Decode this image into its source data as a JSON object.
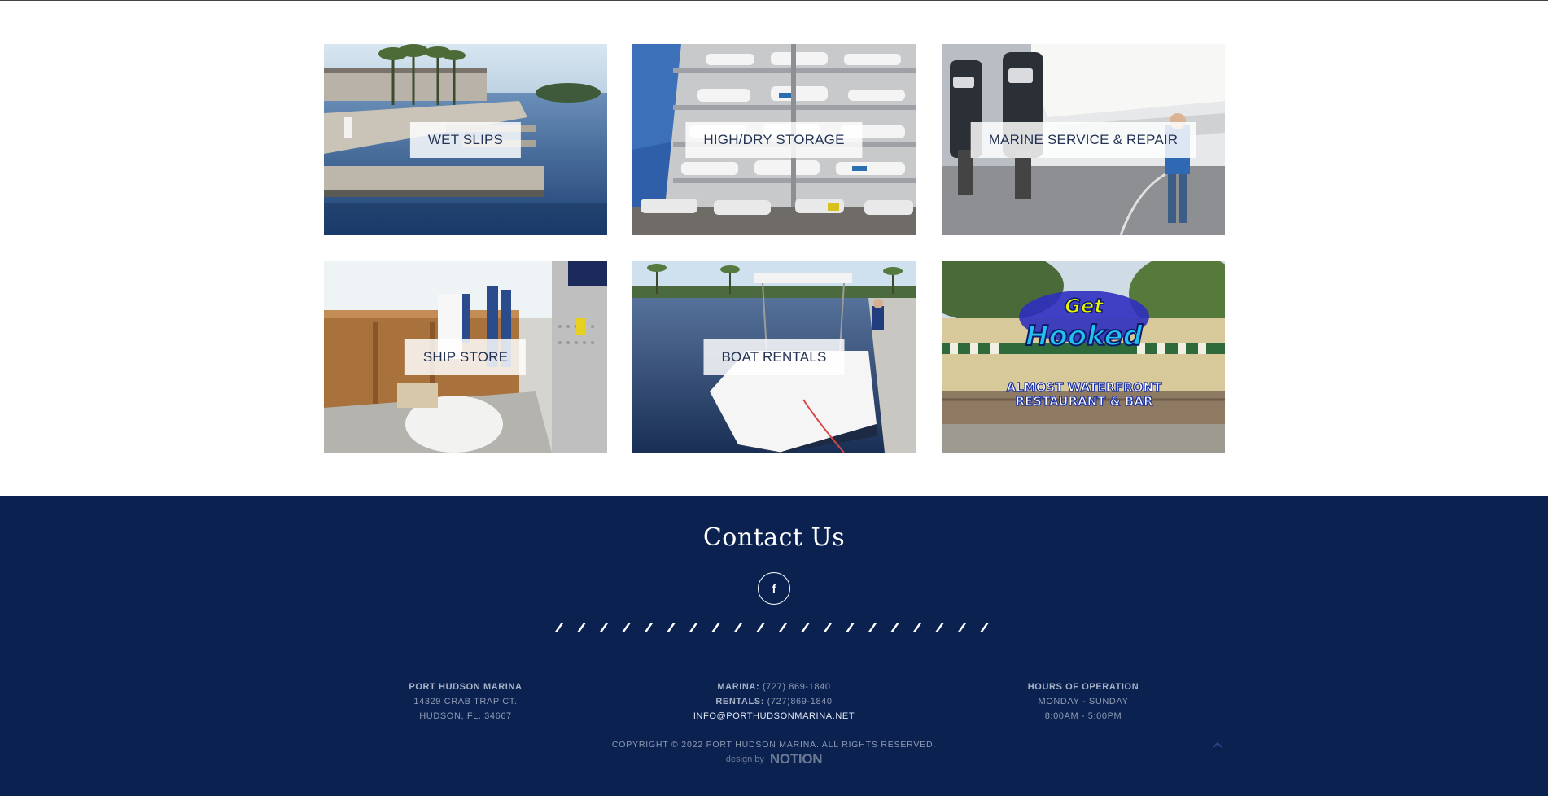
{
  "tiles": [
    {
      "label": "WET SLIPS",
      "icon": "photo-marina-docks"
    },
    {
      "label": "HIGH/DRY STORAGE",
      "icon": "photo-boat-rack-storage"
    },
    {
      "label": "MARINE SERVICE & REPAIR",
      "icon": "photo-boat-engines"
    },
    {
      "label": "SHIP STORE",
      "icon": "photo-store-interior"
    },
    {
      "label": "BOAT RENTALS",
      "icon": "photo-rental-boat"
    },
    {
      "label": "",
      "icon": "photo-restaurant-logo",
      "logo_text": [
        "Get",
        "Hooked",
        "ALMOST WATERFRONT",
        "RESTAURANT & BAR"
      ]
    }
  ],
  "footer": {
    "title": "Contact Us",
    "social": {
      "icon": "facebook-icon",
      "glyph": "f"
    },
    "address": {
      "name": "PORT HUDSON MARINA",
      "street": "14329 CRAB TRAP CT.",
      "city": "HUDSON, FL. 34667"
    },
    "phones": {
      "marina_label": "MARINA:",
      "marina_value": "(727) 869-1840",
      "rentals_label": "RENTALS:",
      "rentals_value": "(727)869-1840",
      "email": "INFO@PORTHUDSONMARINA.NET"
    },
    "hours": {
      "title": "HOURS OF OPERATION",
      "days": "MONDAY - SUNDAY",
      "time": "8:00AM - 5:00PM"
    },
    "copyright": "COPYRIGHT © 2022 PORT HUDSON MARINA. ALL RIGHTS RESERVED.",
    "credit_prefix": "design by",
    "credit_brand": "NOTION"
  },
  "colors": {
    "footer_bg": "#0b2250",
    "tile_label_text": "#243354"
  }
}
